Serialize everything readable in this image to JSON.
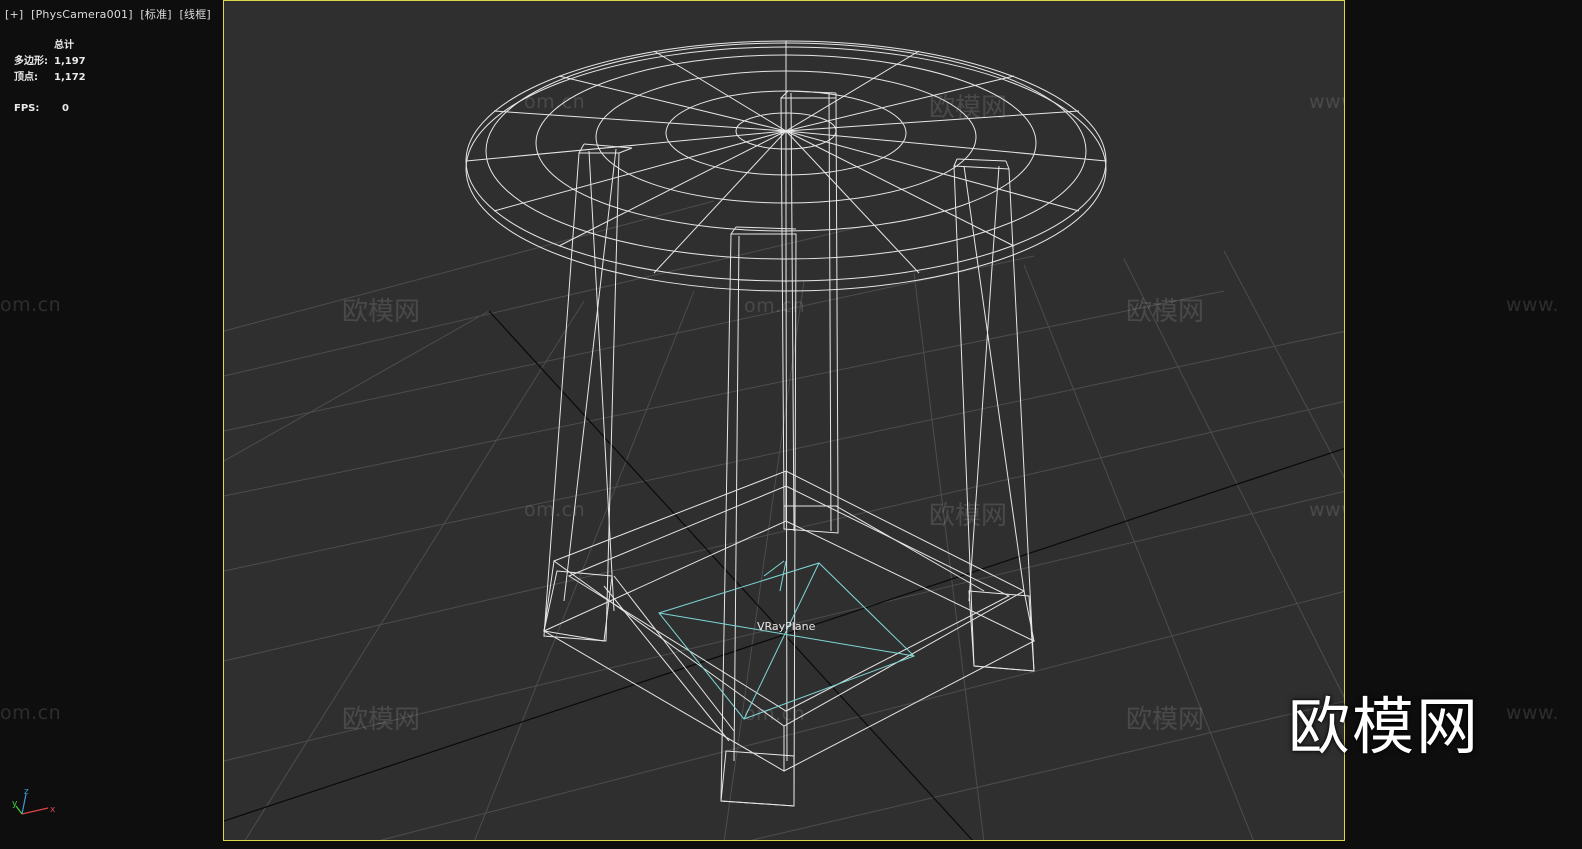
{
  "viewport": {
    "menu": [
      "[+]",
      "[PhysCamera001]",
      "[标准]",
      "[线框]"
    ]
  },
  "stats": {
    "header": "总计",
    "polygons_label": "多边形:",
    "polygons_value": "1,197",
    "vertices_label": "顶点:",
    "vertices_value": "1,172",
    "fps_label": "FPS:",
    "fps_value": "0"
  },
  "scene": {
    "object_label": "VRayPlane",
    "wireframe_color": "#e8e8e8",
    "vray_color": "#7fd6d6",
    "grid_color": "#4a4a4a"
  },
  "watermarks": {
    "cn": "欧模网",
    "url": "www.om.cn",
    "url_partial": "om.cn",
    "url_partial_left": "www."
  },
  "brand": {
    "logo_text": "欧模网"
  },
  "gizmo": {
    "x": "x",
    "y": "y",
    "z": "z"
  }
}
